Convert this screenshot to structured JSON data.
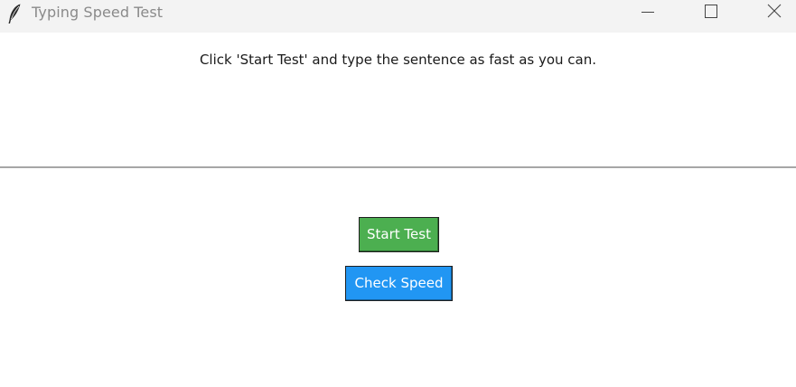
{
  "window": {
    "title": "Typing Speed Test",
    "icon": "feather-icon",
    "controls": [
      "minimize-icon",
      "maximize-icon",
      "close-icon"
    ]
  },
  "main": {
    "instruction": "Click 'Start Test' and type the sentence as fast as you can.",
    "start_button": "Start Test",
    "check_button": "Check Speed"
  },
  "colors": {
    "start_button_bg": "#4caf50",
    "check_button_bg": "#2196f3",
    "button_text": "#ffffff",
    "titlebar_bg": "#f3f3f3"
  }
}
